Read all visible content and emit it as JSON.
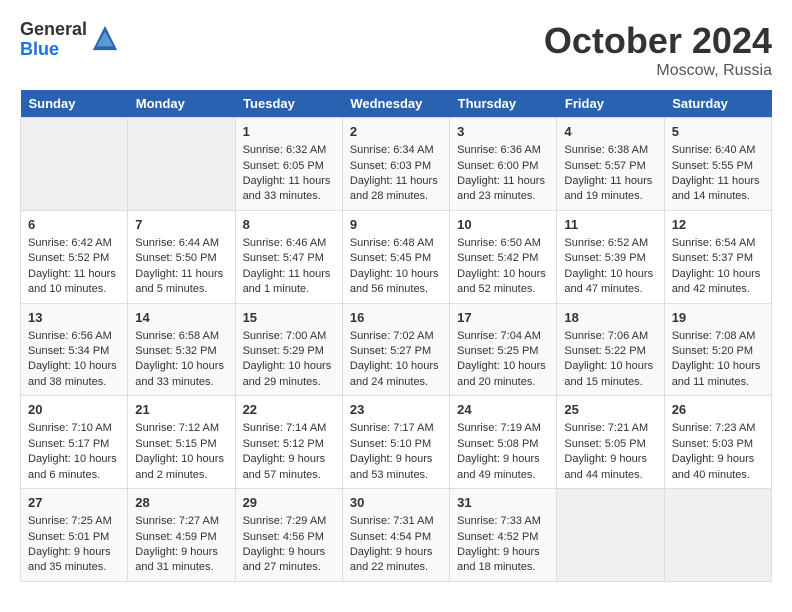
{
  "header": {
    "logo_general": "General",
    "logo_blue": "Blue",
    "title": "October 2024",
    "location": "Moscow, Russia"
  },
  "columns": [
    "Sunday",
    "Monday",
    "Tuesday",
    "Wednesday",
    "Thursday",
    "Friday",
    "Saturday"
  ],
  "weeks": [
    [
      {
        "day": "",
        "sunrise": "",
        "sunset": "",
        "daylight": ""
      },
      {
        "day": "",
        "sunrise": "",
        "sunset": "",
        "daylight": ""
      },
      {
        "day": "1",
        "sunrise": "Sunrise: 6:32 AM",
        "sunset": "Sunset: 6:05 PM",
        "daylight": "Daylight: 11 hours and 33 minutes."
      },
      {
        "day": "2",
        "sunrise": "Sunrise: 6:34 AM",
        "sunset": "Sunset: 6:03 PM",
        "daylight": "Daylight: 11 hours and 28 minutes."
      },
      {
        "day": "3",
        "sunrise": "Sunrise: 6:36 AM",
        "sunset": "Sunset: 6:00 PM",
        "daylight": "Daylight: 11 hours and 23 minutes."
      },
      {
        "day": "4",
        "sunrise": "Sunrise: 6:38 AM",
        "sunset": "Sunset: 5:57 PM",
        "daylight": "Daylight: 11 hours and 19 minutes."
      },
      {
        "day": "5",
        "sunrise": "Sunrise: 6:40 AM",
        "sunset": "Sunset: 5:55 PM",
        "daylight": "Daylight: 11 hours and 14 minutes."
      }
    ],
    [
      {
        "day": "6",
        "sunrise": "Sunrise: 6:42 AM",
        "sunset": "Sunset: 5:52 PM",
        "daylight": "Daylight: 11 hours and 10 minutes."
      },
      {
        "day": "7",
        "sunrise": "Sunrise: 6:44 AM",
        "sunset": "Sunset: 5:50 PM",
        "daylight": "Daylight: 11 hours and 5 minutes."
      },
      {
        "day": "8",
        "sunrise": "Sunrise: 6:46 AM",
        "sunset": "Sunset: 5:47 PM",
        "daylight": "Daylight: 11 hours and 1 minute."
      },
      {
        "day": "9",
        "sunrise": "Sunrise: 6:48 AM",
        "sunset": "Sunset: 5:45 PM",
        "daylight": "Daylight: 10 hours and 56 minutes."
      },
      {
        "day": "10",
        "sunrise": "Sunrise: 6:50 AM",
        "sunset": "Sunset: 5:42 PM",
        "daylight": "Daylight: 10 hours and 52 minutes."
      },
      {
        "day": "11",
        "sunrise": "Sunrise: 6:52 AM",
        "sunset": "Sunset: 5:39 PM",
        "daylight": "Daylight: 10 hours and 47 minutes."
      },
      {
        "day": "12",
        "sunrise": "Sunrise: 6:54 AM",
        "sunset": "Sunset: 5:37 PM",
        "daylight": "Daylight: 10 hours and 42 minutes."
      }
    ],
    [
      {
        "day": "13",
        "sunrise": "Sunrise: 6:56 AM",
        "sunset": "Sunset: 5:34 PM",
        "daylight": "Daylight: 10 hours and 38 minutes."
      },
      {
        "day": "14",
        "sunrise": "Sunrise: 6:58 AM",
        "sunset": "Sunset: 5:32 PM",
        "daylight": "Daylight: 10 hours and 33 minutes."
      },
      {
        "day": "15",
        "sunrise": "Sunrise: 7:00 AM",
        "sunset": "Sunset: 5:29 PM",
        "daylight": "Daylight: 10 hours and 29 minutes."
      },
      {
        "day": "16",
        "sunrise": "Sunrise: 7:02 AM",
        "sunset": "Sunset: 5:27 PM",
        "daylight": "Daylight: 10 hours and 24 minutes."
      },
      {
        "day": "17",
        "sunrise": "Sunrise: 7:04 AM",
        "sunset": "Sunset: 5:25 PM",
        "daylight": "Daylight: 10 hours and 20 minutes."
      },
      {
        "day": "18",
        "sunrise": "Sunrise: 7:06 AM",
        "sunset": "Sunset: 5:22 PM",
        "daylight": "Daylight: 10 hours and 15 minutes."
      },
      {
        "day": "19",
        "sunrise": "Sunrise: 7:08 AM",
        "sunset": "Sunset: 5:20 PM",
        "daylight": "Daylight: 10 hours and 11 minutes."
      }
    ],
    [
      {
        "day": "20",
        "sunrise": "Sunrise: 7:10 AM",
        "sunset": "Sunset: 5:17 PM",
        "daylight": "Daylight: 10 hours and 6 minutes."
      },
      {
        "day": "21",
        "sunrise": "Sunrise: 7:12 AM",
        "sunset": "Sunset: 5:15 PM",
        "daylight": "Daylight: 10 hours and 2 minutes."
      },
      {
        "day": "22",
        "sunrise": "Sunrise: 7:14 AM",
        "sunset": "Sunset: 5:12 PM",
        "daylight": "Daylight: 9 hours and 57 minutes."
      },
      {
        "day": "23",
        "sunrise": "Sunrise: 7:17 AM",
        "sunset": "Sunset: 5:10 PM",
        "daylight": "Daylight: 9 hours and 53 minutes."
      },
      {
        "day": "24",
        "sunrise": "Sunrise: 7:19 AM",
        "sunset": "Sunset: 5:08 PM",
        "daylight": "Daylight: 9 hours and 49 minutes."
      },
      {
        "day": "25",
        "sunrise": "Sunrise: 7:21 AM",
        "sunset": "Sunset: 5:05 PM",
        "daylight": "Daylight: 9 hours and 44 minutes."
      },
      {
        "day": "26",
        "sunrise": "Sunrise: 7:23 AM",
        "sunset": "Sunset: 5:03 PM",
        "daylight": "Daylight: 9 hours and 40 minutes."
      }
    ],
    [
      {
        "day": "27",
        "sunrise": "Sunrise: 7:25 AM",
        "sunset": "Sunset: 5:01 PM",
        "daylight": "Daylight: 9 hours and 35 minutes."
      },
      {
        "day": "28",
        "sunrise": "Sunrise: 7:27 AM",
        "sunset": "Sunset: 4:59 PM",
        "daylight": "Daylight: 9 hours and 31 minutes."
      },
      {
        "day": "29",
        "sunrise": "Sunrise: 7:29 AM",
        "sunset": "Sunset: 4:56 PM",
        "daylight": "Daylight: 9 hours and 27 minutes."
      },
      {
        "day": "30",
        "sunrise": "Sunrise: 7:31 AM",
        "sunset": "Sunset: 4:54 PM",
        "daylight": "Daylight: 9 hours and 22 minutes."
      },
      {
        "day": "31",
        "sunrise": "Sunrise: 7:33 AM",
        "sunset": "Sunset: 4:52 PM",
        "daylight": "Daylight: 9 hours and 18 minutes."
      },
      {
        "day": "",
        "sunrise": "",
        "sunset": "",
        "daylight": ""
      },
      {
        "day": "",
        "sunrise": "",
        "sunset": "",
        "daylight": ""
      }
    ]
  ]
}
